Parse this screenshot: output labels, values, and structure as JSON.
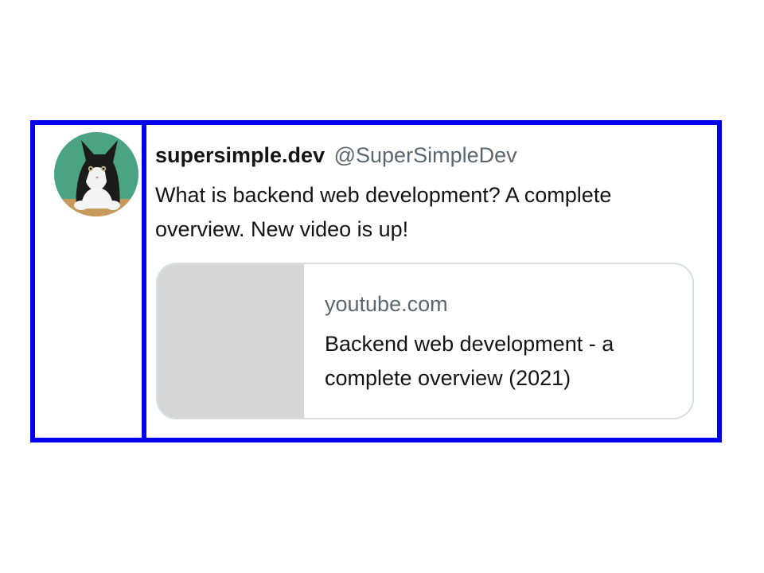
{
  "tweet": {
    "display_name": "supersimple.dev",
    "handle": "@SuperSimpleDev",
    "text": "What is backend web development? A complete overview. New video is up!",
    "link_card": {
      "domain": "youtube.com",
      "title": "Backend web development - a complete overview (2021)"
    }
  },
  "colors": {
    "outline": "#0000ee",
    "name_text": "#141414",
    "secondary_text": "#5b6770",
    "card_border": "#d8dde1",
    "thumb_placeholder": "#d6d6d6",
    "avatar_background": "#4aa383"
  },
  "icons": {
    "avatar": "cat-avatar-icon"
  }
}
